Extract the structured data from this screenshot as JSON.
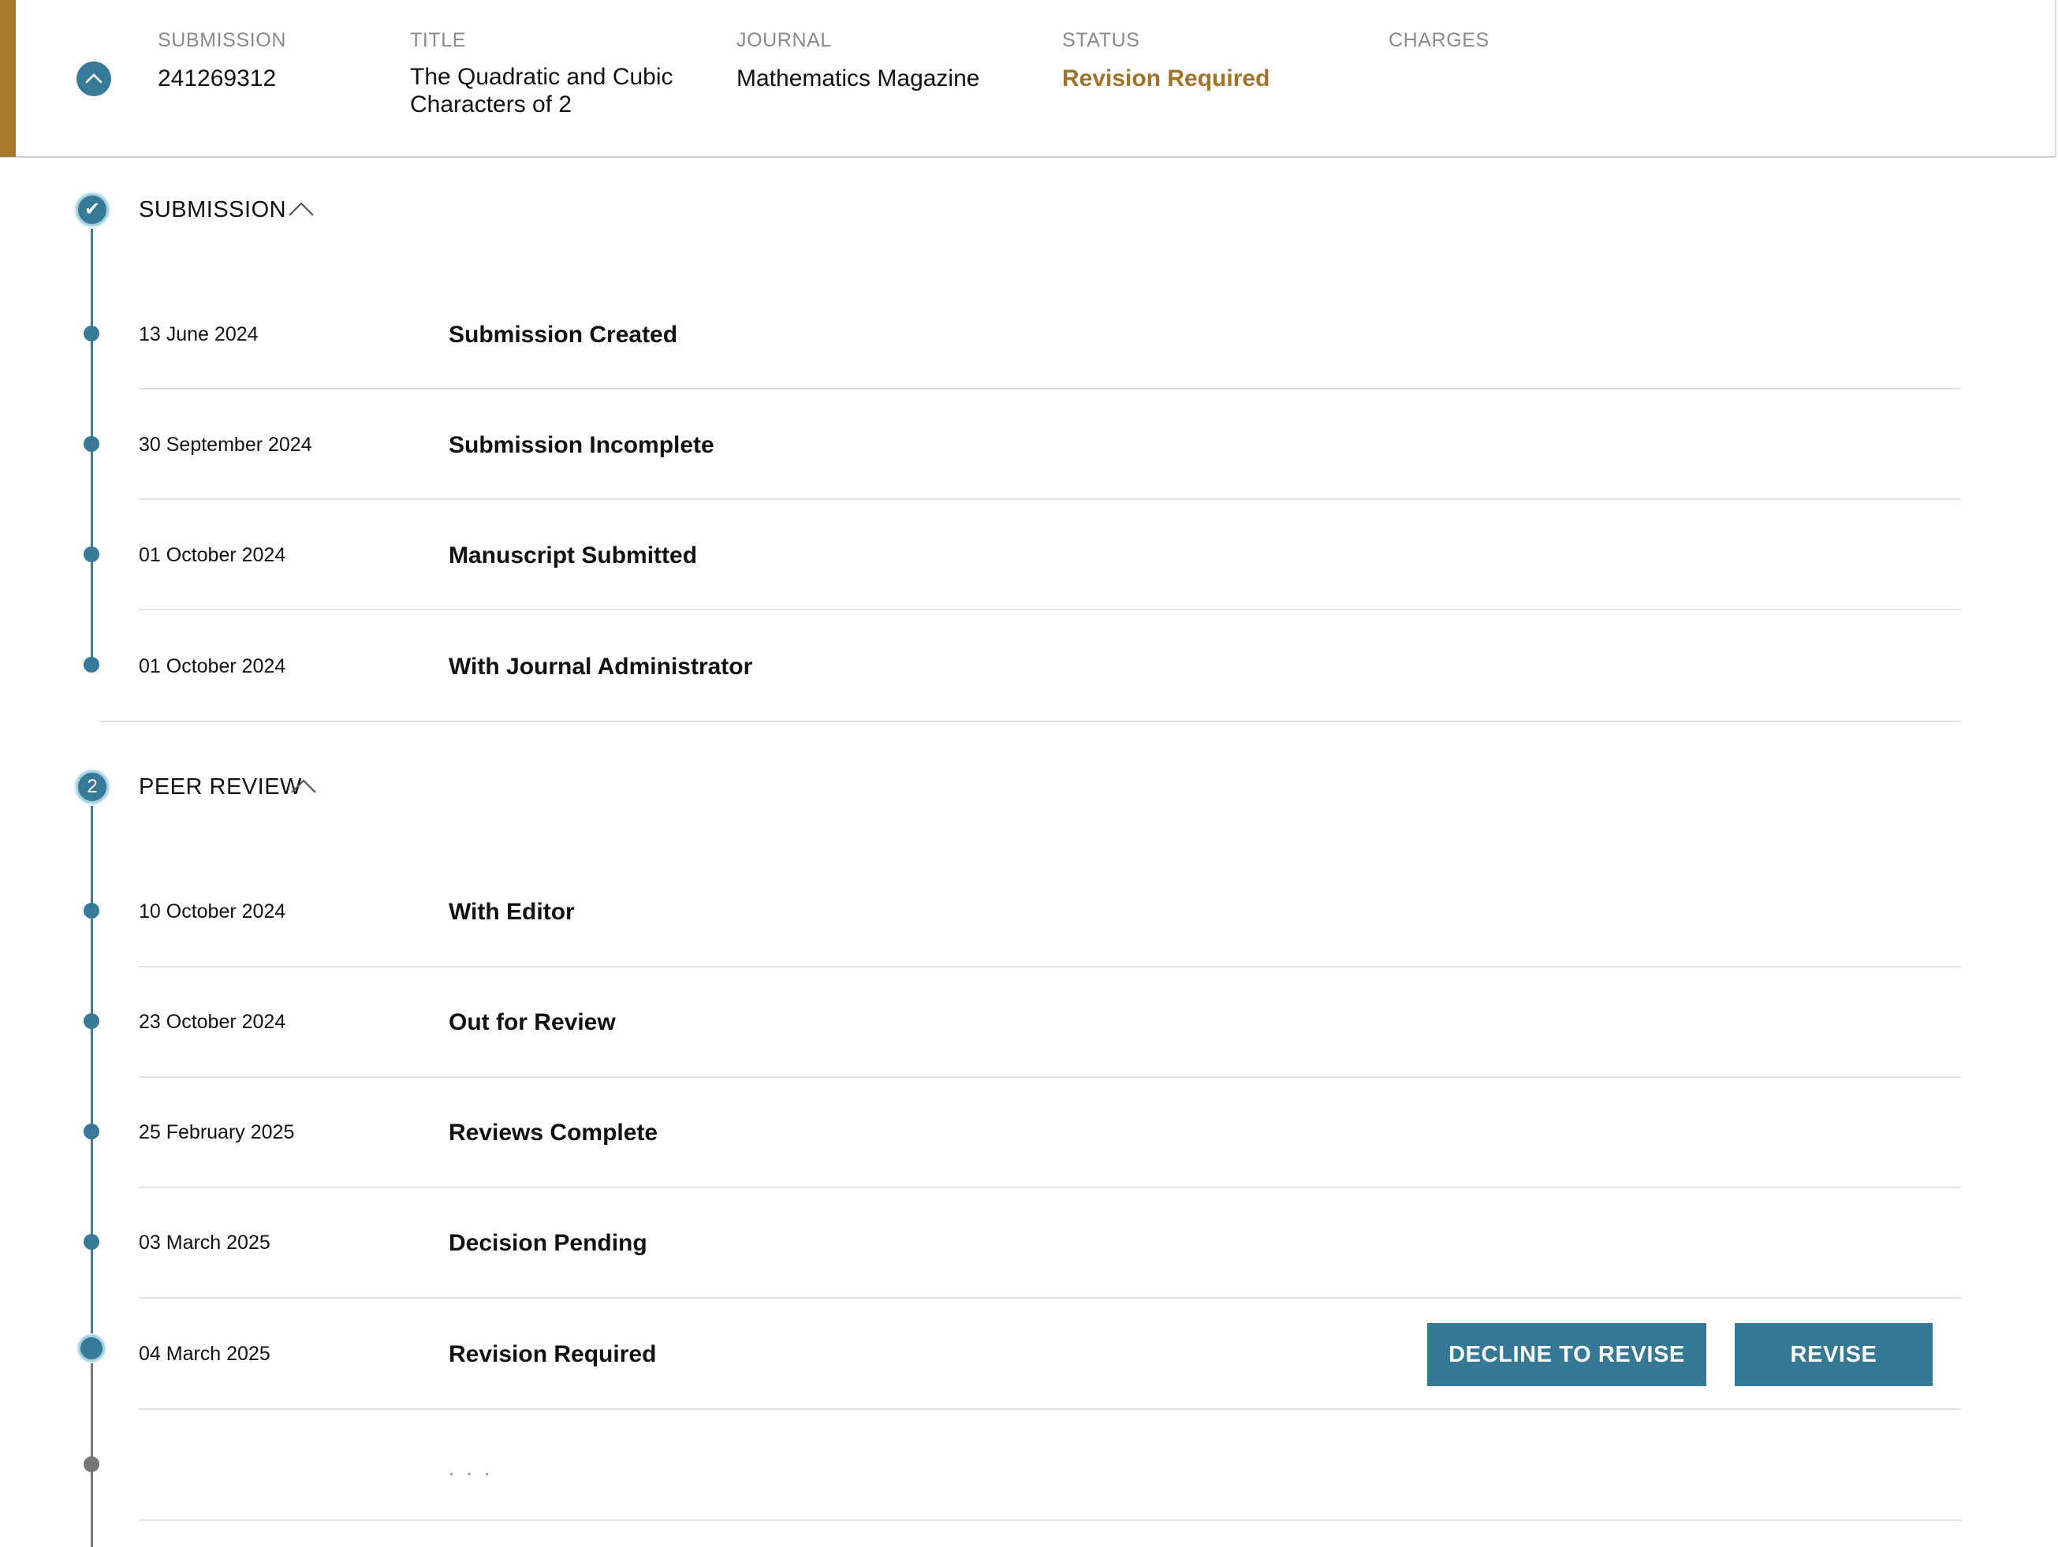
{
  "summary": {
    "submission_label": "SUBMISSION",
    "submission_value": "241269312",
    "title_label": "TITLE",
    "title_value": "The Quadratic and Cubic Characters of 2",
    "journal_label": "JOURNAL",
    "journal_value": "Mathematics Magazine",
    "status_label": "STATUS",
    "status_value": "Revision Required",
    "charges_label": "CHARGES",
    "collapse_icon": "chevron-up-icon"
  },
  "stages": [
    {
      "badge": "✔",
      "badge_icon": "checkmark-icon",
      "title": "SUBMISSION",
      "events": [
        {
          "date": "13 June 2024",
          "name": "Submission Created"
        },
        {
          "date": "30 September 2024",
          "name": "Submission Incomplete"
        },
        {
          "date": "01 October 2024",
          "name": "Manuscript Submitted"
        },
        {
          "date": "01 October 2024",
          "name": "With Journal Administrator"
        }
      ]
    },
    {
      "badge": "2",
      "title": "PEER REVIEW",
      "events": [
        {
          "date": "10 October 2024",
          "name": "With Editor"
        },
        {
          "date": "23 October 2024",
          "name": "Out for Review"
        },
        {
          "date": "25 February 2025",
          "name": "Reviews Complete"
        },
        {
          "date": "03 March 2025",
          "name": "Decision Pending"
        },
        {
          "date": "04 March 2025",
          "name": "Revision Required"
        },
        {
          "date": "",
          "name": ". . ."
        }
      ]
    }
  ],
  "actions": {
    "decline_label": "DECLINE TO REVISE",
    "revise_label": "REVISE"
  },
  "colors": {
    "accent": "#367a98",
    "status": "#a0722a",
    "header_bar": "#a67a28"
  }
}
